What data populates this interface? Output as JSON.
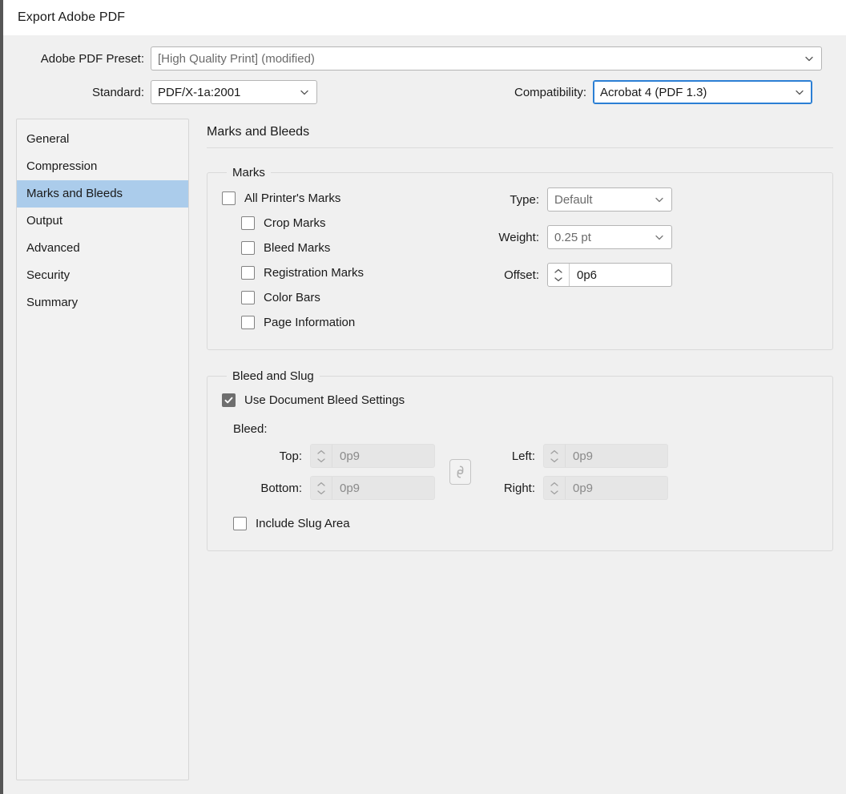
{
  "window": {
    "title": "Export Adobe PDF"
  },
  "header": {
    "preset": {
      "label": "Adobe PDF Preset:",
      "value": "[High Quality Print] (modified)",
      "icon": "chevron-down-icon"
    },
    "standard": {
      "label": "Standard:",
      "value": "PDF/X-1a:2001",
      "icon": "chevron-down-icon"
    },
    "compatibility": {
      "label": "Compatibility:",
      "value": "Acrobat 4 (PDF 1.3)",
      "icon": "chevron-down-icon",
      "focus_color": "#2b7fd4"
    }
  },
  "sidebar": {
    "selected": "Marks and Bleeds",
    "selected_color": "#abcceb",
    "items": [
      {
        "label": "General"
      },
      {
        "label": "Compression"
      },
      {
        "label": "Marks and Bleeds"
      },
      {
        "label": "Output"
      },
      {
        "label": "Advanced"
      },
      {
        "label": "Security"
      },
      {
        "label": "Summary"
      }
    ]
  },
  "panel": {
    "title": "Marks and Bleeds",
    "marks_group": {
      "legend": "Marks",
      "checkboxes": [
        {
          "label": "All Printer's Marks",
          "checked": false,
          "indent": false
        },
        {
          "label": "Crop Marks",
          "checked": false,
          "indent": true
        },
        {
          "label": "Bleed Marks",
          "checked": false,
          "indent": true
        },
        {
          "label": "Registration Marks",
          "checked": false,
          "indent": true
        },
        {
          "label": "Color Bars",
          "checked": false,
          "indent": true
        },
        {
          "label": "Page Information",
          "checked": false,
          "indent": true
        }
      ],
      "type": {
        "label": "Type:",
        "value": "Default",
        "icon": "chevron-down-icon"
      },
      "weight": {
        "label": "Weight:",
        "value": "0.25 pt",
        "icon": "chevron-down-icon"
      },
      "offset": {
        "label": "Offset:",
        "value": "0p6",
        "icon": "spinner-icon",
        "disabled": false
      }
    },
    "bleed_group": {
      "legend": "Bleed and Slug",
      "use_document_bleed": {
        "label": "Use Document Bleed Settings",
        "checked": true
      },
      "bleed_label": "Bleed:",
      "fields": {
        "top": {
          "label": "Top:",
          "value": "0p9",
          "disabled": true
        },
        "bottom": {
          "label": "Bottom:",
          "value": "0p9",
          "disabled": true
        },
        "left": {
          "label": "Left:",
          "value": "0p9",
          "disabled": true
        },
        "right": {
          "label": "Right:",
          "value": "0p9",
          "disabled": true
        }
      },
      "chain": {
        "icon": "link-chain-icon",
        "linked": false
      },
      "include_slug": {
        "label": "Include Slug Area",
        "checked": false
      }
    }
  }
}
